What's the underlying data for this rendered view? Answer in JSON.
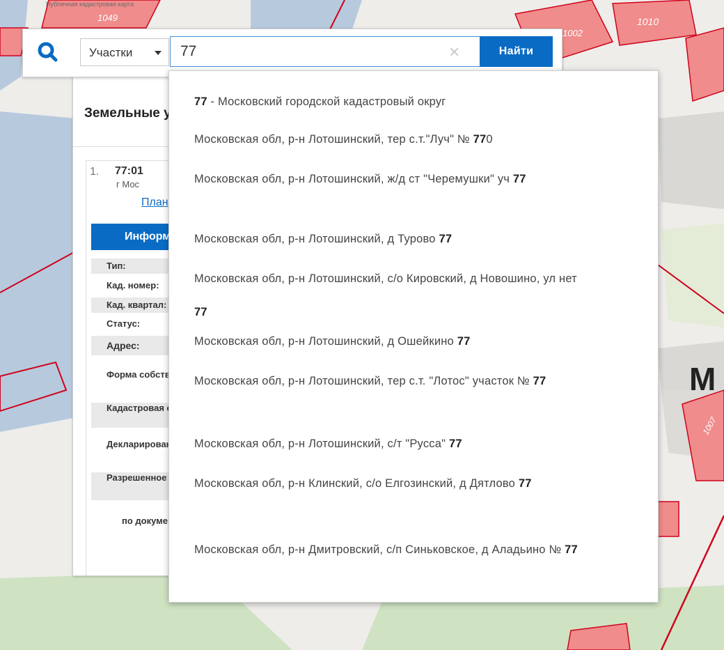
{
  "map": {
    "corner_label": "Публичная кадастровая карта",
    "parcel_labels": [
      "1049",
      "1002",
      "1010",
      "1007"
    ],
    "district_letter": "М"
  },
  "search": {
    "type_select": "Участки",
    "query": "77",
    "clear_glyph": "×",
    "button": "Найти"
  },
  "panel": {
    "title": "Земельные участки",
    "item_number": "1.",
    "item_kad": "77:01",
    "item_addr": "г Мос",
    "item_link": "План",
    "info_tab": "Информация",
    "props": [
      "Тип:",
      "Кад. номер:",
      "Кад. квартал:",
      "Статус:",
      "Адрес:",
      "Форма собственности:",
      "Кадастровая стоимость:",
      "Декларированная площадь:",
      "Разрешенное использование:",
      "по документу:"
    ]
  },
  "suggestions": [
    {
      "pre": "",
      "bold": "77",
      "post": " - Московский городской кадастровый округ"
    },
    {
      "pre": "Московская обл, р-н Лотошинский, тер с.т.\"Луч\" № ",
      "bold": "77",
      "post": "0"
    },
    {
      "pre": "Московская обл, р-н Лотошинский, ж/д ст \"Черемушки\" уч",
      "bold": "77",
      "post": "",
      "wrap": true
    },
    {
      "pre": "Московская обл, р-н Лотошинский, д Турово ",
      "bold": "77",
      "post": ""
    },
    {
      "pre": "Московская обл, р-н Лотошинский, с/о Кировский, д Новошино, ул нет ",
      "bold": "77",
      "post": "",
      "wrap": true
    },
    {
      "pre": "Московская обл, р-н Лотошинский, д Ошейкино ",
      "bold": "77",
      "post": ""
    },
    {
      "pre": "Московская обл, р-н Лотошинский, тер с.т. \"Лотос\" участок № ",
      "bold": "77",
      "post": "",
      "wrap": true
    },
    {
      "pre": "Московская обл, р-н Лотошинский, с/т \"Русса\" ",
      "bold": "77",
      "post": ""
    },
    {
      "pre": "Московская обл, р-н Клинский, с/о Елгозинский, д Дятлово",
      "bold": "77",
      "post": "",
      "wrap": true
    },
    {
      "pre": "Московская обл, р-н Дмитровский, с/п Синьковское, д Аладьино № ",
      "bold": "77",
      "post": "",
      "wrap": true
    }
  ],
  "colors": {
    "accent": "#0a6bc4",
    "parcel_fill": "#f08c8c",
    "parcel_border": "#d0021b",
    "water": "#b7c9dd",
    "green": "#cfe3c2"
  }
}
